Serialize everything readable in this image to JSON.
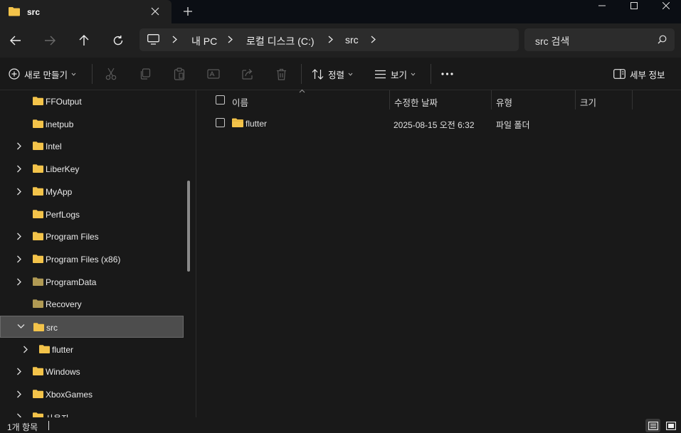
{
  "tab": {
    "title": "src"
  },
  "address": {
    "crumbs": [
      "내 PC",
      "로컬 디스크 (C:)",
      "src"
    ]
  },
  "search": {
    "placeholder": "src 검색"
  },
  "commands": {
    "new": "새로 만들기",
    "sort": "정렬",
    "view": "보기",
    "details": "세부 정보"
  },
  "sidebar": {
    "items": [
      {
        "label": "FFOutput",
        "expandable": false,
        "indent": 0,
        "color": "#f3c34a"
      },
      {
        "label": "inetpub",
        "expandable": false,
        "indent": 0,
        "color": "#f3c34a"
      },
      {
        "label": "Intel",
        "expandable": true,
        "indent": 0,
        "color": "#f3c34a"
      },
      {
        "label": "LiberKey",
        "expandable": true,
        "indent": 0,
        "color": "#f3c34a"
      },
      {
        "label": "MyApp",
        "expandable": true,
        "indent": 0,
        "color": "#f3c34a"
      },
      {
        "label": "PerfLogs",
        "expandable": false,
        "indent": 0,
        "color": "#f3c34a"
      },
      {
        "label": "Program Files",
        "expandable": true,
        "indent": 0,
        "color": "#f3c34a"
      },
      {
        "label": "Program Files (x86)",
        "expandable": true,
        "indent": 0,
        "color": "#f3c34a"
      },
      {
        "label": "ProgramData",
        "expandable": true,
        "indent": 0,
        "color": "#b09a54"
      },
      {
        "label": "Recovery",
        "expandable": false,
        "indent": 0,
        "color": "#b09a54"
      },
      {
        "label": "src",
        "expandable": true,
        "expanded": true,
        "selected": true,
        "indent": 0,
        "color": "#f3c34a"
      },
      {
        "label": "flutter",
        "expandable": true,
        "indent": 1,
        "color": "#f3c34a"
      },
      {
        "label": "Windows",
        "expandable": true,
        "indent": 0,
        "color": "#f3c34a"
      },
      {
        "label": "XboxGames",
        "expandable": true,
        "indent": 0,
        "color": "#f3c34a"
      },
      {
        "label": "사용자",
        "expandable": true,
        "indent": 0,
        "color": "#f3c34a"
      }
    ]
  },
  "columns": {
    "name": "이름",
    "modified": "수정한 날짜",
    "type": "유형",
    "size": "크기"
  },
  "files": [
    {
      "name": "flutter",
      "modified": "2025-08-15 오전 6:32",
      "type": "파일 폴더",
      "size": ""
    }
  ],
  "status": {
    "count": "1개 항목"
  },
  "colors": {
    "background": "#191919",
    "titlebar": "#0b0e14",
    "toolbar": "#202020",
    "folder": "#f3c34a",
    "selected": "#4d4d4d"
  }
}
